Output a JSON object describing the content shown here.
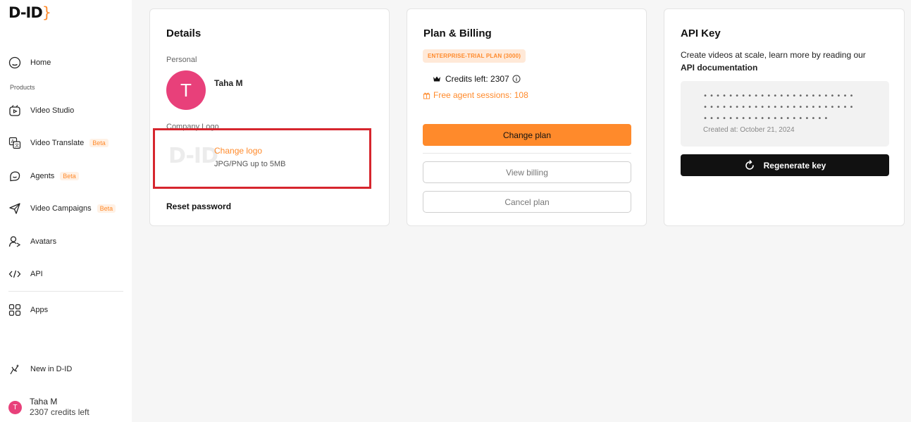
{
  "sidebar": {
    "logo": "D-ID",
    "logo_brace": "}",
    "home": "Home",
    "products_label": "Products",
    "video_studio": "Video Studio",
    "video_translate": "Video Translate",
    "agents": "Agents",
    "video_campaigns": "Video Campaigns",
    "avatars": "Avatars",
    "api": "API",
    "apps": "Apps",
    "new_in": "New in D-ID",
    "beta": "Beta",
    "user_initial": "T",
    "user_name": "Taha M",
    "user_credits": "2307 credits left"
  },
  "details": {
    "title": "Details",
    "personal_label": "Personal",
    "avatar_initial": "T",
    "name": "Taha M",
    "company_logo_label": "Company Logo",
    "logo_placeholder": "D-ID",
    "change_logo": "Change logo",
    "logo_hint": "JPG/PNG up to 5MB",
    "reset_password": "Reset password"
  },
  "billing": {
    "title": "Plan & Billing",
    "plan_badge": "ENTERPRISE-TRIAL PLAN (3000)",
    "credits_left": "Credits left: 2307",
    "free_sessions": "Free agent sessions: 108",
    "change_plan": "Change plan",
    "view_billing": "View billing",
    "cancel_plan": "Cancel plan"
  },
  "api_key": {
    "title": "API Key",
    "desc_prefix": "Create videos at scale, learn more by reading our",
    "desc_link": "API documentation",
    "masked_line_1": "••••••••••••••••••••••••",
    "masked_line_2": "••••••••••••••••••••••••",
    "masked_line_3": "••••••••••••••••••••",
    "created_at": "Created at: October 21, 2024",
    "regenerate": "Regenerate key"
  },
  "colors": {
    "accent": "#ff8a2b",
    "avatar": "#e8407a",
    "highlight": "#d6262e"
  }
}
